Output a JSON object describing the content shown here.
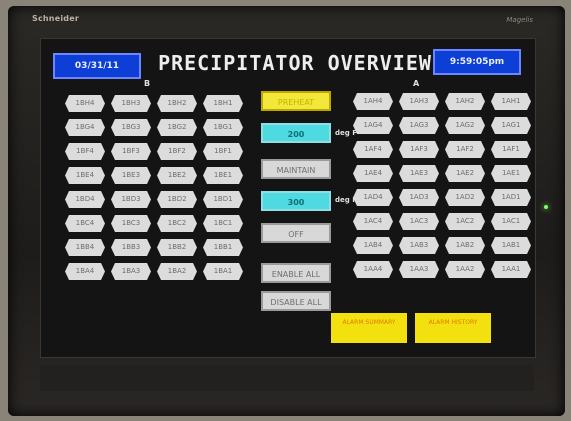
{
  "brand": {
    "left": "Schneider",
    "right": "Magelis"
  },
  "header": {
    "date": "03/31/11",
    "title": "PRECIPITATOR OVERVIEW",
    "time": "9:59:05pm"
  },
  "column_b": {
    "label": "B",
    "rows": [
      [
        "1BH4",
        "1BH3",
        "1BH2",
        "1BH1"
      ],
      [
        "1BG4",
        "1BG3",
        "1BG2",
        "1BG1"
      ],
      [
        "1BF4",
        "1BF3",
        "1BF2",
        "1BF1"
      ],
      [
        "1BE4",
        "1BE3",
        "1BE2",
        "1BE1"
      ],
      [
        "1BD4",
        "1BD3",
        "1BD2",
        "1BD1"
      ],
      [
        "1BC4",
        "1BC3",
        "1BC2",
        "1BC1"
      ],
      [
        "1BB4",
        "1BB3",
        "1BB2",
        "1BB1"
      ],
      [
        "1BA4",
        "1BA3",
        "1BA2",
        "1BA1"
      ]
    ]
  },
  "column_a": {
    "label": "A",
    "rows": [
      [
        "1AH4",
        "1AH3",
        "1AH2",
        "1AH1"
      ],
      [
        "1AG4",
        "1AG3",
        "1AG2",
        "1AG1"
      ],
      [
        "1AF4",
        "1AF3",
        "1AF2",
        "1AF1"
      ],
      [
        "1AE4",
        "1AE3",
        "1AE2",
        "1AE1"
      ],
      [
        "1AD4",
        "1AD3",
        "1AD2",
        "1AD1"
      ],
      [
        "1AC4",
        "1AC3",
        "1AC2",
        "1AC1"
      ],
      [
        "1AB4",
        "1AB3",
        "1AB2",
        "1AB1"
      ],
      [
        "1AA4",
        "1AA3",
        "1AA2",
        "1AA1"
      ]
    ]
  },
  "controls": {
    "preheat": "PREHEAT",
    "setpoint1_value": "200",
    "setpoint1_unit": "deg F",
    "maintain": "MAINTAIN",
    "setpoint2_value": "300",
    "setpoint2_unit": "deg F",
    "off": "OFF",
    "enable_all": "ENABLE ALL",
    "disable_all": "DISABLE ALL"
  },
  "alarms": {
    "left": "ALARM SUMMARY",
    "right": "ALARM HISTORY"
  },
  "colors": {
    "header_blue": "#0d3fd6",
    "preheat_yellow": "#f3e83a",
    "setpoint_cyan": "#4fd9e0",
    "alarm_yellow": "#f3e10f"
  }
}
